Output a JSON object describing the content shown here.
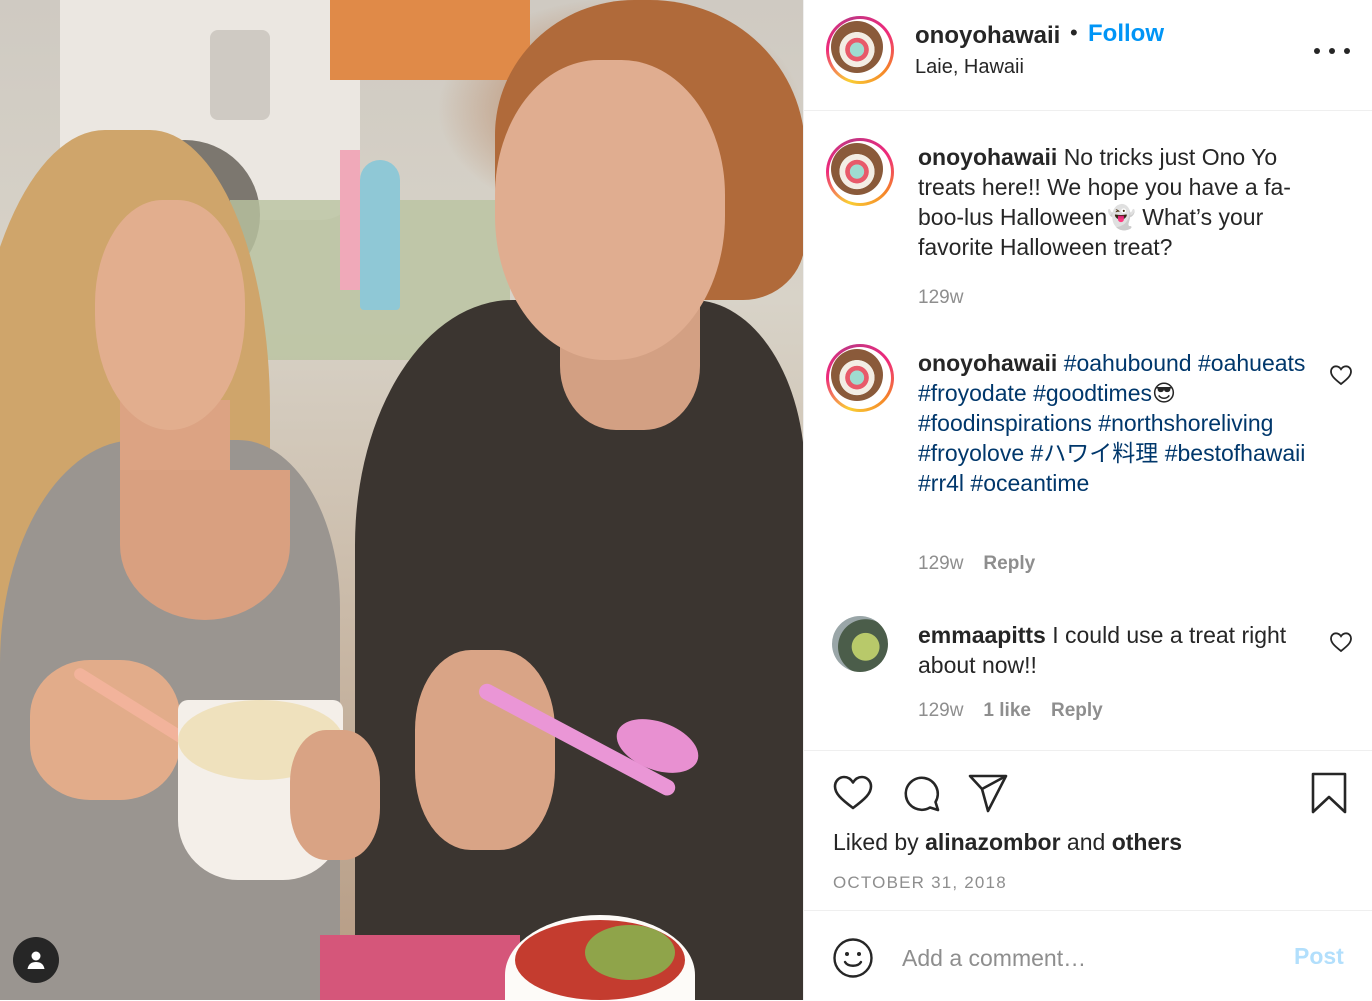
{
  "post": {
    "username": "onoyohawaii",
    "follow_label": "Follow",
    "separator": "•",
    "location": "Laie, Hawaii",
    "more_icon": "more-horizontal-icon"
  },
  "caption": {
    "username": "onoyohawaii",
    "text": "No tricks just Ono Yo treats here!! We hope you have a fa-boo-lus Halloween👻 What’s your favorite Halloween treat?",
    "age": "129w"
  },
  "hashtag_comment": {
    "username": "onoyohawaii",
    "segments": [
      "#oahubound",
      "#oahueats",
      "#froyodate",
      "#goodtimes",
      "😎",
      "#foodinspirations",
      "#northshoreliving",
      "#froyolove",
      "#ハワイ料理",
      "#bestofhawaii",
      "#rr4l",
      "#oceantime"
    ],
    "age": "129w",
    "reply_label": "Reply"
  },
  "user_comment": {
    "username": "emmaapitts",
    "text": "I could use a treat right about now!!",
    "age": "129w",
    "likes": "1 like",
    "reply_label": "Reply"
  },
  "actions": {
    "liked_prefix": "Liked by",
    "liked_user": "alinazombor",
    "liked_and": "and",
    "liked_others": "others",
    "date": "OCTOBER 31, 2018"
  },
  "add_comment": {
    "placeholder": "Add a comment…",
    "post_label": "Post"
  },
  "colors": {
    "link_blue": "#0095f6",
    "hashtag_blue": "#00376b",
    "muted": "#8e8e8e",
    "post_disabled": "#b2dffc"
  }
}
